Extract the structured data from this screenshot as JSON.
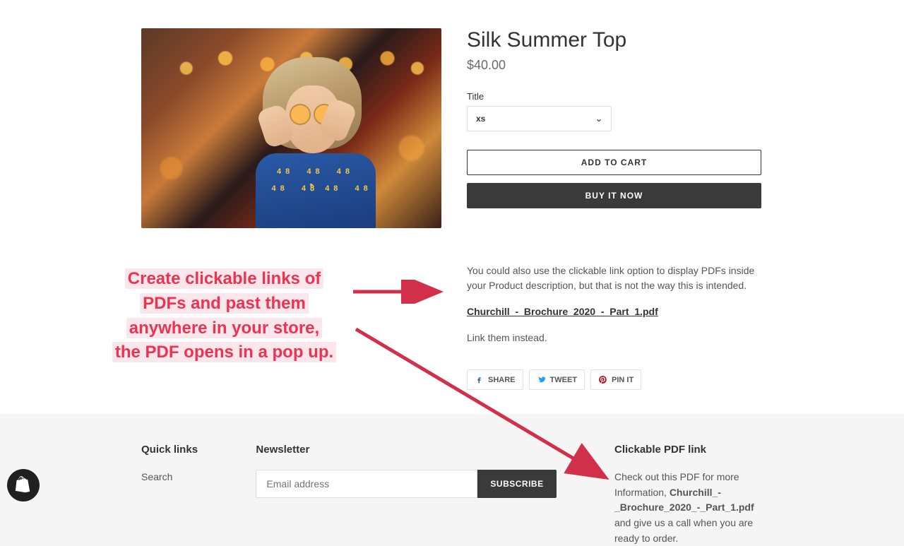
{
  "product": {
    "title": "Silk Summer Top",
    "price": "$40.00",
    "variant_label": "Title",
    "variant_value": "xs",
    "add_to_cart": "ADD TO CART",
    "buy_now": "BUY IT NOW",
    "desc_1": "You could also use the clickable link option to display PDFs inside your Product description, but that is not the way this is intended.",
    "pdf_link": "Churchill_-_Brochure_2020_-_Part_1.pdf",
    "desc_2": "Link them instead."
  },
  "share": {
    "fb": "SHARE",
    "tw": "TWEET",
    "pin": "PIN IT"
  },
  "footer": {
    "quick_links_title": "Quick links",
    "search": "Search",
    "newsletter_title": "Newsletter",
    "email_placeholder": "Email address",
    "subscribe": "SUBSCRIBE",
    "pdf_title": "Clickable PDF link",
    "pdf_pre": "Check out this PDF for more Information, ",
    "pdf_name": "Churchill_-_Brochure_2020_-_Part_1.pdf",
    "pdf_post": " and give us a call when you are ready to order."
  },
  "callout": {
    "l1": "Create clickable links of",
    "l2": "PDFs and past them",
    "l3": "anywhere in your store,",
    "l4": "the PDF opens in a pop up."
  }
}
